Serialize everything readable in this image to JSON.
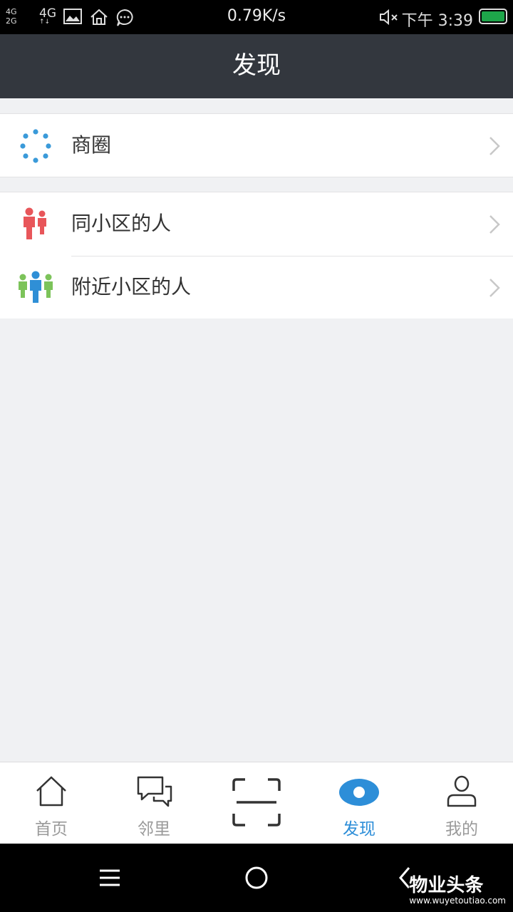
{
  "status_bar": {
    "signal_top": "4G",
    "signal_bottom": "2G",
    "network": "4G",
    "speed": "0.79K/s",
    "time": "下午 3:39"
  },
  "header": {
    "title": "发现"
  },
  "menu": {
    "business_circle": "商圈",
    "same_community_people": "同小区的人",
    "nearby_community_people": "附近小区的人"
  },
  "tabs": [
    {
      "label": "首页",
      "icon": "home-icon"
    },
    {
      "label": "邻里",
      "icon": "chat-icon"
    },
    {
      "label": "",
      "icon": "scan-icon"
    },
    {
      "label": "发现",
      "icon": "eye-icon"
    },
    {
      "label": "我的",
      "icon": "user-icon"
    }
  ],
  "active_tab": "发现",
  "colors": {
    "accent": "#2d8ed8",
    "header_bg": "#33373e",
    "same_people": "#e8565a",
    "nearby_people": "#7cc35a"
  },
  "watermark": {
    "text": "物业头条",
    "sub": "www.wuyetoutiao.com"
  }
}
